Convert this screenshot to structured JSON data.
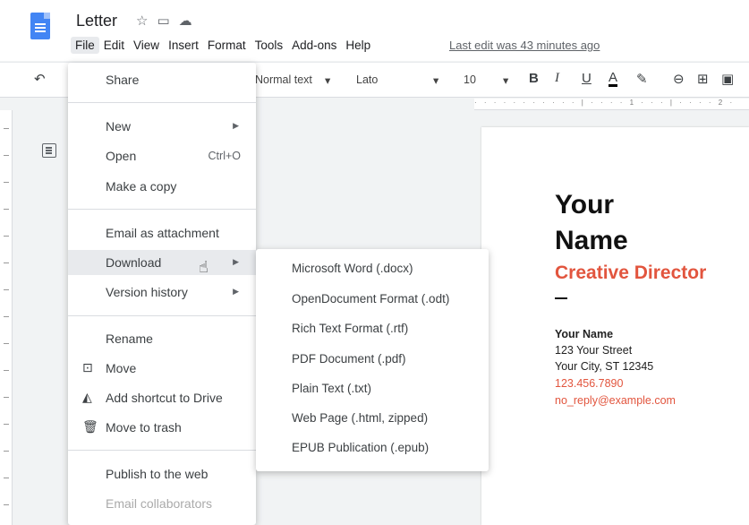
{
  "header": {
    "doc_title": "Letter",
    "last_edit": "Last edit was 43 minutes ago",
    "menus": [
      "File",
      "Edit",
      "View",
      "Insert",
      "Format",
      "Tools",
      "Add-ons",
      "Help"
    ]
  },
  "toolbar": {
    "style": "Normal text",
    "font": "Lato",
    "size": "10"
  },
  "ruler": "· · · · · · ·   · · · · | · · · · 1 · · · | · · · · 2 ·",
  "file_menu": {
    "share": "Share",
    "new": "New",
    "open": "Open",
    "open_shortcut": "Ctrl+O",
    "make_copy": "Make a copy",
    "email_attachment": "Email as attachment",
    "download": "Download",
    "version_history": "Version history",
    "rename": "Rename",
    "move": "Move",
    "add_shortcut": "Add shortcut to Drive",
    "move_trash": "Move to trash",
    "publish": "Publish to the web",
    "email_collaborators": "Email collaborators"
  },
  "download_menu": [
    "Microsoft Word (.docx)",
    "OpenDocument Format (.odt)",
    "Rich Text Format (.rtf)",
    "PDF Document (.pdf)",
    "Plain Text (.txt)",
    "Web Page (.html, zipped)",
    "EPUB Publication (.epub)"
  ],
  "page": {
    "line1": "Your",
    "line2": "Name",
    "role": "Creative Director",
    "contact_name": "Your Name",
    "street": "123 Your Street",
    "city": "Your City, ST 12345",
    "phone": "123.456.7890",
    "email": "no_reply@example.com"
  },
  "colors": {
    "accent": "#e2553e",
    "docs_blue": "#4285f4"
  }
}
